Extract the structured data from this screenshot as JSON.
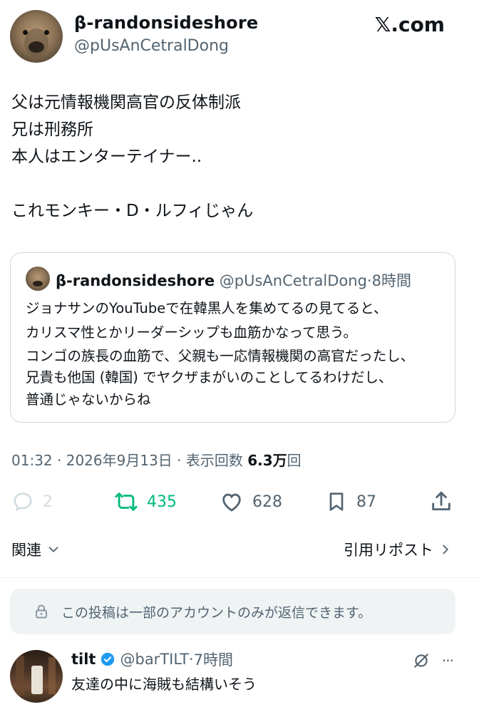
{
  "post": {
    "author_name": "β-randonsideshore",
    "author_handle": "@pUsAnCetralDong",
    "site_logo": "𝕏.com",
    "body_lines": [
      "父は元情報機関高官の反体制派",
      "兄は刑務所",
      "本人はエンターテイナー..",
      "これモンキー・D・ルフィじゃん"
    ]
  },
  "quote": {
    "author_name": "β-randonsideshore",
    "author_handle": "@pUsAnCetralDong",
    "separator": "·",
    "time": "8時間",
    "lines": [
      "ジョナサンのYouTubeで在韓黒人を集めてるの見てると、",
      "カリスマ性とかリーダーシップも血筋かなって思う。",
      "コンゴの族長の血筋で、父親も一応情報機関の高官だったし、",
      "兄貴も他国 (韓国) でヤクザまがいのことしてるわけだし、",
      "普通じゃないからね"
    ]
  },
  "meta": {
    "time": "01:32",
    "sep1": " · ",
    "date": "2026年9月13日",
    "sep2": " · ",
    "views_label": "表示回数 ",
    "views_value": "6.3万",
    "views_suffix": "回"
  },
  "actions": {
    "replies": "2",
    "reposts": "435",
    "likes": "628",
    "bookmarks": "87",
    "repost_color": "#00ba7c",
    "muted_color": "#536471"
  },
  "links": {
    "related": "関連",
    "quote_posts": "引用リポスト"
  },
  "reply_restriction": {
    "text": "この投稿は一部のアカウントのみが返信できます。",
    "icon": "lock-icon"
  },
  "reply": {
    "author_name": "tilt",
    "verified": true,
    "author_handle": "@barTILT",
    "separator": "·",
    "time": "7時間",
    "text": "友達の中に海賊も結構いそう",
    "more": "···"
  }
}
